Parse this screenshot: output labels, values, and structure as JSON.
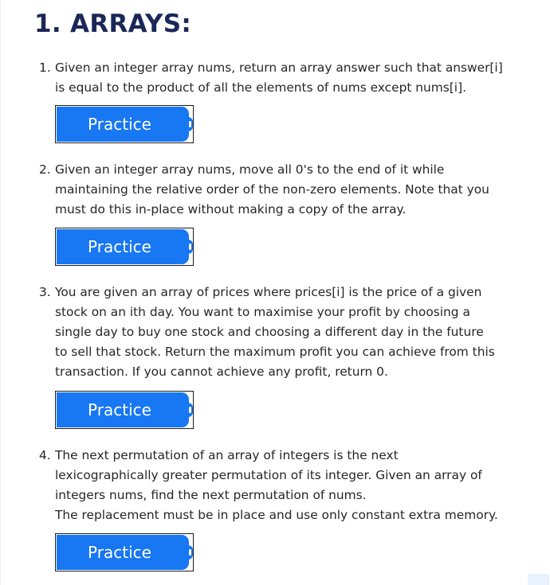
{
  "section": {
    "title": "1. ARRAYS:"
  },
  "problems": [
    {
      "number": "1.",
      "text": "Given an integer array nums, return an array answer such that answer[i]\nis equal to the product of all the elements of nums except nums[i].",
      "button_label": "Practice"
    },
    {
      "number": "2.",
      "text": "Given an integer array nums, move all 0's to the end of it while\nmaintaining the relative order of the non-zero elements. Note that you\nmust do this in-place without making a copy of the array.",
      "button_label": "Practice"
    },
    {
      "number": "3.",
      "text": "You are given an array of prices where prices[i] is the price of a given\nstock on an ith day. You want to maximise your profit by choosing a\nsingle day to buy one stock and choosing a different day in the future\nto sell that stock. Return the maximum profit you can achieve from this\ntransaction. If you cannot achieve any profit, return 0.",
      "button_label": "Practice"
    },
    {
      "number": "4.",
      "text": "The next permutation of an array of integers is the next\nlexicographically greater permutation of its integer. Given an array of\nintegers nums, find the next permutation of nums.\nThe replacement must be in place and use only constant extra memory.",
      "button_label": "Practice"
    }
  ],
  "colors": {
    "heading": "#1a2757",
    "button": "#1877f2",
    "body_text": "#262626"
  }
}
